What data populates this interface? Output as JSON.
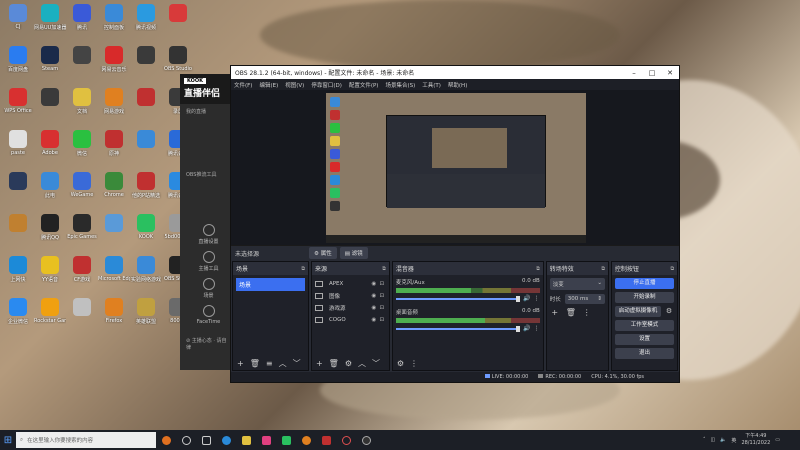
{
  "desktop": {
    "icons": [
      {
        "label": "CJ",
        "color": "#5a8ad8"
      },
      {
        "label": "百度网盘",
        "color": "#2a7cf0"
      },
      {
        "label": "WPS Office",
        "color": "#d83030"
      },
      {
        "label": "paste",
        "color": "#e0e0e0"
      },
      {
        "label": "",
        "color": "#2a3a5a"
      },
      {
        "label": "",
        "color": "#c08030"
      },
      {
        "label": "上网快",
        "color": "#1c8ad8"
      },
      {
        "label": "企业微信",
        "color": "#2a8af0"
      },
      {
        "label": "网易UU加速器",
        "color": "#1ab0c0"
      },
      {
        "label": "Steam",
        "color": "#1a2a4a"
      },
      {
        "label": "",
        "color": "#3a3a3a"
      },
      {
        "label": "Adobe",
        "color": "#d83030"
      },
      {
        "label": "此电",
        "color": "#3a8ad8"
      },
      {
        "label": "腾讯QQ",
        "color": "#222222"
      },
      {
        "label": "YY语音",
        "color": "#e8c020"
      },
      {
        "label": "Rockstar Games",
        "color": "#f0a010"
      },
      {
        "label": "腾讯",
        "color": "#3a5ad8"
      },
      {
        "label": "",
        "color": "#444444"
      },
      {
        "label": "文档",
        "color": "#e0c040"
      },
      {
        "label": "微信",
        "color": "#2ac040"
      },
      {
        "label": "WeGame",
        "color": "#3a6ad8"
      },
      {
        "label": "Epic Games",
        "color": "#2a2a2a"
      },
      {
        "label": "CF游戏",
        "color": "#c03030"
      },
      {
        "label": "",
        "color": "#c0c0c0"
      },
      {
        "label": "控制面板",
        "color": "#3a8ad8"
      },
      {
        "label": "网易云音乐",
        "color": "#d82a2a"
      },
      {
        "label": "网易游戏",
        "color": "#e08020"
      },
      {
        "label": "原神",
        "color": "#c03030"
      },
      {
        "label": "Chrome",
        "color": "#3a8a3a"
      },
      {
        "label": "",
        "color": "#5a9ad8"
      },
      {
        "label": "Microsoft Edge",
        "color": "#2a8ad8"
      },
      {
        "label": "Firefox",
        "color": "#e08020"
      },
      {
        "label": "腾讯视频",
        "color": "#2a9ae0"
      },
      {
        "label": "",
        "color": "#3a3a3a"
      },
      {
        "label": "",
        "color": "#c03030"
      },
      {
        "label": "",
        "color": "#3a8ad8"
      },
      {
        "label": "他的P站精选",
        "color": "#c03030"
      },
      {
        "label": "KOOK",
        "color": "#2ac060"
      },
      {
        "label": "实验网络游戏",
        "color": "#3a8ad8"
      },
      {
        "label": "英雄联盟",
        "color": "#c0a040"
      },
      {
        "label": "",
        "color": "#d83a3a"
      },
      {
        "label": "OBS Studio",
        "color": "#333333"
      },
      {
        "label": "录屏",
        "color": "#3a3a3a"
      },
      {
        "label": "腾讯会议",
        "color": "#2a6ad8"
      },
      {
        "label": "腾讯会议",
        "color": "#2a8ae0"
      },
      {
        "label": "5bd0002...",
        "color": "#9a9a9a"
      },
      {
        "label": "OBS Studio",
        "color": "#222222"
      },
      {
        "label": "800px",
        "color": "#6a6a6a"
      }
    ]
  },
  "kook": {
    "badge": "KOOK",
    "title": "直播伴侣",
    "items": [
      "我的直播",
      "",
      "",
      "",
      "",
      "OBS推流工具"
    ],
    "tools": [
      "直播设置",
      "主播工具",
      "场景",
      "FaceTime"
    ],
    "warning": "⊘ 主播心态 · 请自律"
  },
  "obs": {
    "title": "OBS 28.1.2 (64-bit, windows) - 配置文件: 未命名 - 场景: 未命名",
    "menu": [
      "文件(F)",
      "编辑(E)",
      "视图(V)",
      "停靠窗口(D)",
      "配置文件(P)",
      "场景集合(S)",
      "工具(T)",
      "帮助(H)"
    ],
    "source_bar": {
      "label": "未选择源",
      "props": "⚙ 属性",
      "filters": "▤ 滤镜"
    },
    "scenes": {
      "title": "场景",
      "items": [
        "场景"
      ]
    },
    "sources": {
      "title": "来源",
      "items": [
        {
          "name": "APEX",
          "icon": "monitor-icon"
        },
        {
          "name": "图像",
          "icon": "image-icon"
        },
        {
          "name": "游戏源",
          "icon": "gamepad-icon"
        },
        {
          "name": "COGO",
          "icon": "monitor-icon"
        }
      ]
    },
    "mixer": {
      "title": "混音器",
      "channels": [
        {
          "name": "麦克风/Aux",
          "db": "0.0 dB",
          "level": 0.52
        },
        {
          "name": "桌面音频",
          "db": "0.0 dB",
          "level": 0.62
        }
      ]
    },
    "transitions": {
      "title": "转场特效",
      "type": "淡变",
      "duration_label": "时长",
      "duration": "300 ms"
    },
    "controls": {
      "title": "控制按钮",
      "stop_stream": "停止直播",
      "start_record": "开始录制",
      "virtual_cam": "启动虚拟摄像机",
      "studio_mode": "工作室模式",
      "settings": "设置",
      "exit": "退出"
    },
    "status": {
      "live": "LIVE: 00:00:00",
      "rec": "REC: 00:00:00",
      "cpu": "CPU: 4.1%, 30.00 fps"
    }
  },
  "taskbar": {
    "search_placeholder": "在这里输入你要搜索的内容",
    "time": "下午4:49",
    "date": "28/11/2022",
    "lang": "英"
  }
}
